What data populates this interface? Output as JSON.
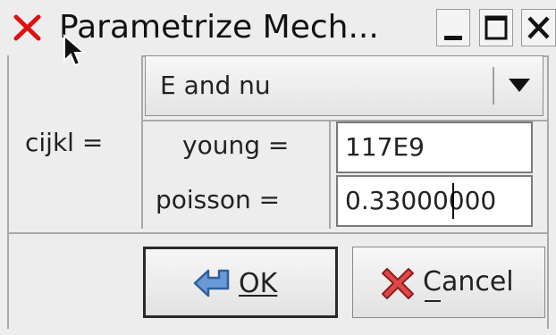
{
  "window": {
    "title": "Parametrize Mech...",
    "icon": "close-x-icon",
    "controls": [
      "minimize-icon",
      "maximize-icon",
      "close-icon"
    ]
  },
  "form": {
    "cijkl_label": "cijkl =",
    "mode": {
      "selected": "E and nu",
      "options_visible": [
        "E and nu"
      ]
    },
    "young_label": "young =",
    "young_value": "117E9",
    "poisson_label": "poisson =",
    "poisson_value": "0.33000000"
  },
  "buttons": {
    "ok_label": "OK",
    "ok_mnemonic": "O",
    "cancel_label": "Cancel",
    "cancel_mnemonic": "C"
  },
  "colors": {
    "window_bg": "#ededed",
    "app_icon": "#e01010",
    "ok_icon": "#4a7fc0",
    "cancel_icon": "#d43a3a"
  }
}
